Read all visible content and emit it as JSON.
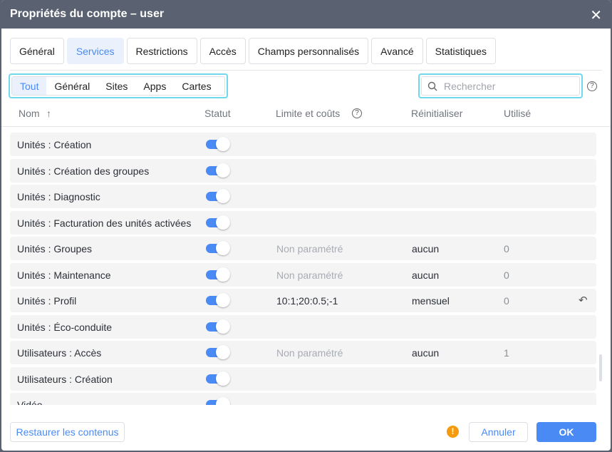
{
  "title": "Propriétés du compte – user",
  "tabs": [
    "Général",
    "Services",
    "Restrictions",
    "Accès",
    "Champs personnalisés",
    "Avancé",
    "Statistiques"
  ],
  "subtabs": [
    "Tout",
    "Général",
    "Sites",
    "Apps",
    "Cartes"
  ],
  "search": {
    "placeholder": "Rechercher"
  },
  "columns": {
    "name": "Nom",
    "sort": "↑",
    "status": "Statut",
    "limit": "Limite et coûts",
    "reset": "Réinitialiser",
    "used": "Utilisé"
  },
  "rows": [
    {
      "name": "Unités : Création",
      "enabled": true,
      "limit": "",
      "reset": "",
      "used": ""
    },
    {
      "name": "Unités : Création des groupes",
      "enabled": true,
      "limit": "",
      "reset": "",
      "used": ""
    },
    {
      "name": "Unités : Diagnostic",
      "enabled": true,
      "limit": "",
      "reset": "",
      "used": ""
    },
    {
      "name": "Unités : Facturation des unités activées",
      "enabled": true,
      "limit": "",
      "reset": "",
      "used": ""
    },
    {
      "name": "Unités : Groupes",
      "enabled": true,
      "limit": "Non paramétré",
      "reset": "aucun",
      "used": "0"
    },
    {
      "name": "Unités : Maintenance",
      "enabled": true,
      "limit": "Non paramétré",
      "reset": "aucun",
      "used": "0"
    },
    {
      "name": "Unités : Profil",
      "enabled": true,
      "limit": "10:1;20:0.5;-1",
      "reset": "mensuel",
      "used": "0"
    },
    {
      "name": "Unités : Éco-conduite",
      "enabled": true,
      "limit": "",
      "reset": "",
      "used": ""
    },
    {
      "name": "Utilisateurs : Accès",
      "enabled": true,
      "limit": "Non paramétré",
      "reset": "aucun",
      "used": "1"
    },
    {
      "name": "Utilisateurs : Création",
      "enabled": true,
      "limit": "",
      "reset": "",
      "used": ""
    },
    {
      "name": "Vidéo",
      "enabled": true,
      "limit": "",
      "reset": "",
      "used": ""
    }
  ],
  "footer": {
    "restore": "Restaurer les contenus",
    "cancel": "Annuler",
    "ok": "OK",
    "warning": "!"
  }
}
